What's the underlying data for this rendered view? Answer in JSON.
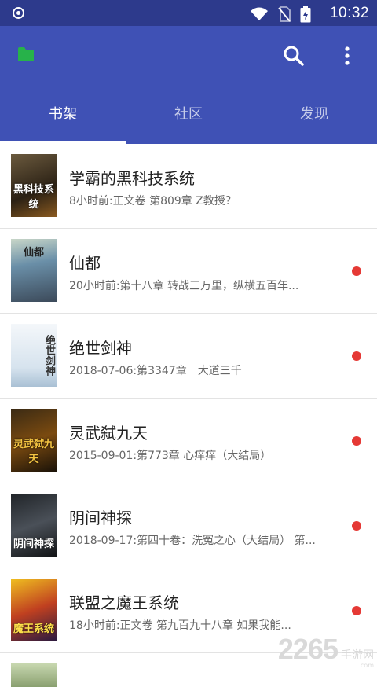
{
  "status_bar": {
    "time": "10:32"
  },
  "app_bar": {
    "tabs": [
      {
        "label": "书架",
        "active": true
      },
      {
        "label": "社区",
        "active": false
      },
      {
        "label": "发现",
        "active": false
      }
    ],
    "icons": [
      "folder-icon",
      "search-icon",
      "more-icon"
    ],
    "colors": {
      "primary": "#3f51b5",
      "status": "#2d3a8c",
      "folder": "#27b24a",
      "unread": "#e53935"
    }
  },
  "books": [
    {
      "title": "学霸的黑科技系统",
      "latest": "8小时前:正文卷 第809章 Z教授？",
      "unread": false,
      "cover_text": "黑科技系统"
    },
    {
      "title": "仙都",
      "latest": "20小时前:第十八章 转战三万里，纵横五百年...",
      "unread": true,
      "cover_text": "仙都"
    },
    {
      "title": "绝世剑神",
      "latest": "2018-07-06:第3347章　大道三千",
      "unread": true,
      "cover_text": "绝世剑神"
    },
    {
      "title": "灵武弑九天",
      "latest": "2015-09-01:第773章 心痒痒（大结局）",
      "unread": true,
      "cover_text": "灵武弑九天"
    },
    {
      "title": "阴间神探",
      "latest": "2018-09-17:第四十卷：洗冤之心（大结局） 第...",
      "unread": true,
      "cover_text": "阴间神探"
    },
    {
      "title": "联盟之魔王系统",
      "latest": "18小时前:正文卷 第九百九十八章 如果我能...",
      "unread": true,
      "cover_text": "魔王系统"
    }
  ],
  "watermark": {
    "number": "2265",
    "domain": ".com",
    "label": "手游网"
  }
}
